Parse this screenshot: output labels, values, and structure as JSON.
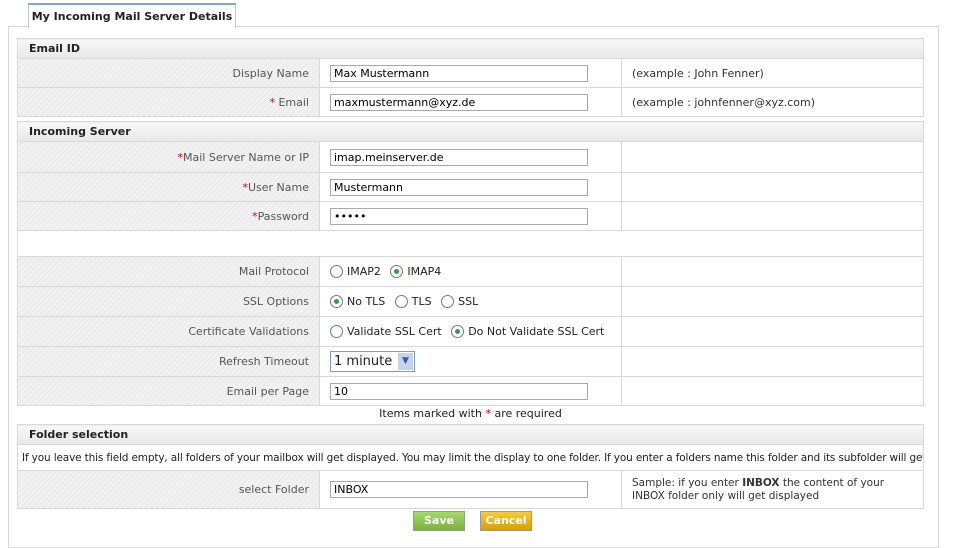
{
  "tab": {
    "label": "My Incoming Mail Server Details"
  },
  "email_section": {
    "title": "Email ID",
    "display_name": {
      "label": "Display Name",
      "value": "Max Mustermann",
      "example": "(example : John Fenner)"
    },
    "email": {
      "required": "*",
      "label": "Email",
      "value": "maxmustermann@xyz.de",
      "example": "(example : johnfenner@xyz.com)"
    }
  },
  "server_section": {
    "title": "Incoming Server",
    "server": {
      "required": "*",
      "label": "Mail Server Name or IP",
      "value": "imap.meinserver.de"
    },
    "user": {
      "required": "*",
      "label": "User Name",
      "value": "Mustermann"
    },
    "password": {
      "required": "*",
      "label": "Password",
      "value": "•••••"
    },
    "protocol": {
      "label": "Mail Protocol",
      "options": [
        "IMAP2",
        "IMAP4"
      ],
      "selected": "IMAP4"
    },
    "ssl": {
      "label": "SSL Options",
      "options": [
        "No TLS",
        "TLS",
        "SSL"
      ],
      "selected": "No TLS"
    },
    "cert": {
      "label": "Certificate Validations",
      "options": [
        "Validate SSL Cert",
        "Do Not Validate SSL Cert"
      ],
      "selected": "Do Not Validate SSL Cert"
    },
    "refresh": {
      "label": "Refresh Timeout",
      "value": "1 minute"
    },
    "per_page": {
      "label": "Email per Page",
      "value": "10"
    }
  },
  "required_note": {
    "before": "Items marked with ",
    "star": "*",
    "after": " are required"
  },
  "folder_section": {
    "title": "Folder selection",
    "info": "If you leave this field empty, all folders of your mailbox will get displayed. You may limit the display to one folder. If you enter a folders name this folder and its subfolder will get displayed.",
    "folder": {
      "label": "select Folder",
      "value": "INBOX",
      "sample_before": "Sample: if you enter ",
      "sample_bold": "INBOX",
      "sample_after": " the content of your INBOX folder only will get displayed"
    }
  },
  "buttons": {
    "save": "Save",
    "cancel": "Cancel"
  },
  "colors": {
    "save": "#8cc63f",
    "cancel": "#e6b000",
    "required": "#cc0000",
    "radio_selected": "#3c9c3c"
  }
}
